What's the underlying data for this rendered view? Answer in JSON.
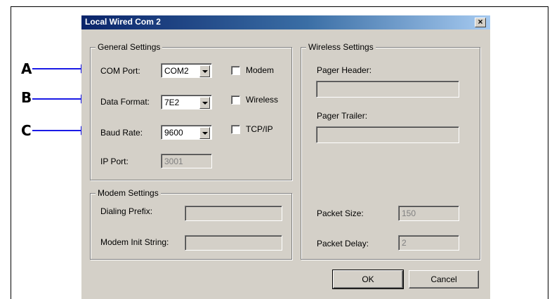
{
  "window": {
    "title": "Local Wired Com 2",
    "close_glyph": "×"
  },
  "callouts": [
    {
      "letter": "A"
    },
    {
      "letter": "B"
    },
    {
      "letter": "C"
    }
  ],
  "callout_color": "#1a1ae6",
  "general": {
    "title": "General Settings",
    "com_port": {
      "label": "COM Port:",
      "value": "COM2"
    },
    "data_format": {
      "label": "Data Format:",
      "value": "7E2"
    },
    "baud_rate": {
      "label": "Baud Rate:",
      "value": "9600"
    },
    "ip_port": {
      "label": "IP Port:",
      "value": "3001"
    },
    "checkboxes": [
      {
        "label": "Modem",
        "checked": false
      },
      {
        "label": "Wireless",
        "checked": false
      },
      {
        "label": "TCP/IP",
        "checked": false
      }
    ]
  },
  "modem": {
    "title": "Modem Settings",
    "dialing_prefix": {
      "label": "Dialing Prefix:",
      "value": ""
    },
    "init_string": {
      "label": "Modem Init String:",
      "value": ""
    }
  },
  "wireless": {
    "title": "Wireless Settings",
    "pager_header": {
      "label": "Pager Header:",
      "value": ""
    },
    "pager_trailer": {
      "label": "Pager Trailer:",
      "value": ""
    },
    "packet_size": {
      "label": "Packet Size:",
      "value": "150"
    },
    "packet_delay": {
      "label": "Packet Delay:",
      "value": "2"
    }
  },
  "buttons": {
    "ok": "OK",
    "cancel": "Cancel"
  }
}
